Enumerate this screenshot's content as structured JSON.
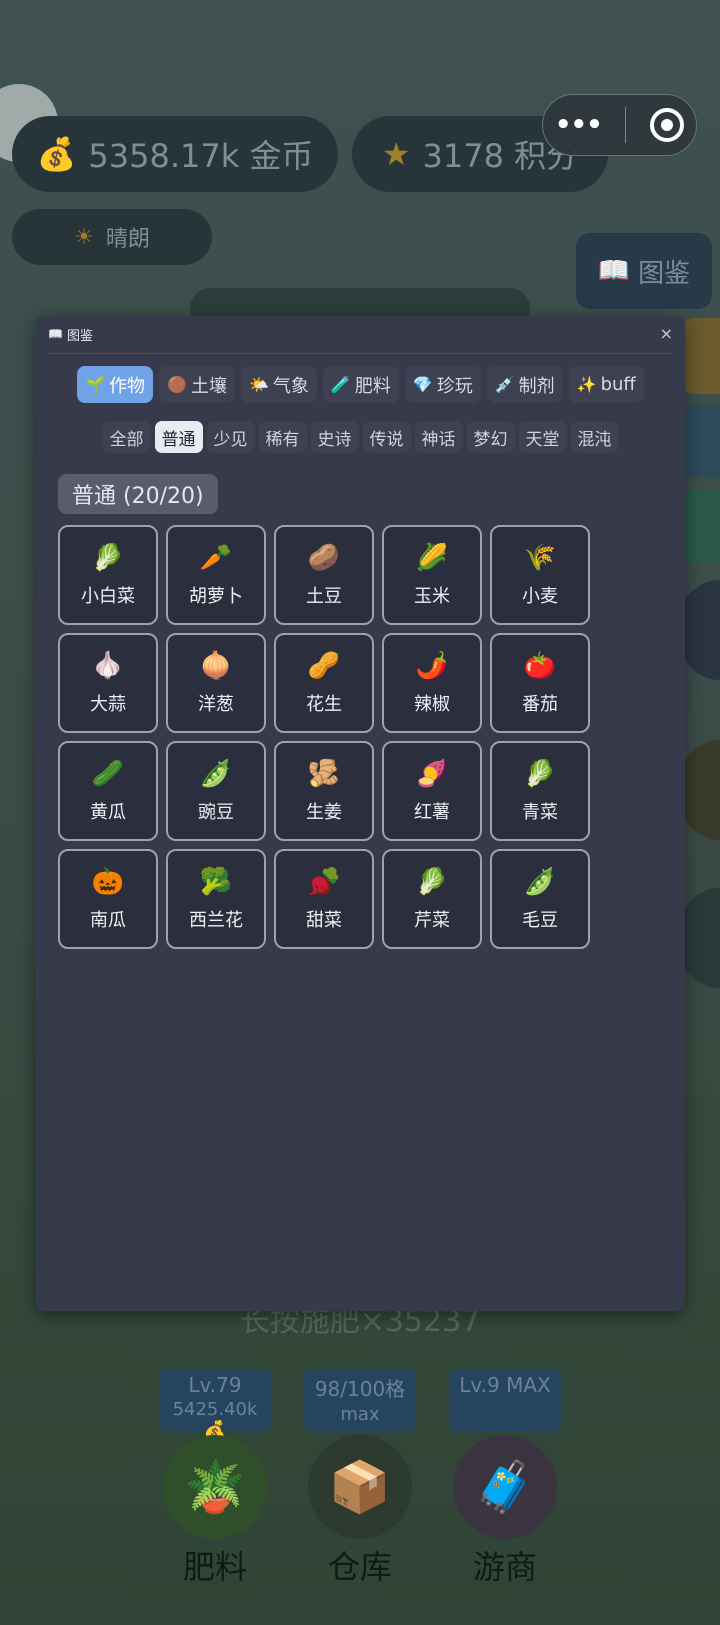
{
  "background": {
    "coins": "5358.17k 金币",
    "score": "3178 积分",
    "weather": "晴朗",
    "top_right_button": "图鉴",
    "bottom_hint": "长按施肥×35237",
    "level_boxes": [
      {
        "line1": "Lv.79",
        "line2": "5425.40k 💰"
      },
      {
        "line1": "98/100格",
        "line2": "max"
      },
      {
        "line1": "Lv.9 MAX",
        "line2": ""
      }
    ],
    "bottom_buttons": [
      {
        "label": "肥料",
        "icon": "🪴"
      },
      {
        "label": "仓库",
        "icon": "📦"
      },
      {
        "label": "游商",
        "icon": "🧳"
      }
    ]
  },
  "dialog": {
    "title": "图鉴",
    "close": "×",
    "categories": [
      {
        "icon": "🌱",
        "label": "作物",
        "active": true
      },
      {
        "icon": "🟤",
        "label": "土壤",
        "active": false
      },
      {
        "icon": "🌤️",
        "label": "气象",
        "active": false
      },
      {
        "icon": "🧪",
        "label": "肥料",
        "active": false
      },
      {
        "icon": "💎",
        "label": "珍玩",
        "active": false
      },
      {
        "icon": "💉",
        "label": "制剂",
        "active": false
      },
      {
        "icon": "✨",
        "label": "buff",
        "active": false
      }
    ],
    "rarities": [
      {
        "label": "全部",
        "active": false
      },
      {
        "label": "普通",
        "active": true
      },
      {
        "label": "少见",
        "active": false
      },
      {
        "label": "稀有",
        "active": false
      },
      {
        "label": "史诗",
        "active": false
      },
      {
        "label": "传说",
        "active": false
      },
      {
        "label": "神话",
        "active": false
      },
      {
        "label": "梦幻",
        "active": false
      },
      {
        "label": "天堂",
        "active": false
      },
      {
        "label": "混沌",
        "active": false
      }
    ],
    "section_title": "普通 (20/20)",
    "items": [
      {
        "icon": "🥬",
        "name": "小白菜"
      },
      {
        "icon": "🥕",
        "name": "胡萝卜"
      },
      {
        "icon": "🥔",
        "name": "土豆"
      },
      {
        "icon": "🌽",
        "name": "玉米"
      },
      {
        "icon": "🌾",
        "name": "小麦"
      },
      {
        "icon": "🧄",
        "name": "大蒜"
      },
      {
        "icon": "🧅",
        "name": "洋葱"
      },
      {
        "icon": "🥜",
        "name": "花生"
      },
      {
        "icon": "🌶️",
        "name": "辣椒"
      },
      {
        "icon": "🍅",
        "name": "番茄"
      },
      {
        "icon": "🥒",
        "name": "黄瓜"
      },
      {
        "icon": "🫛",
        "name": "豌豆"
      },
      {
        "icon": "🫚",
        "name": "生姜"
      },
      {
        "icon": "🍠",
        "name": "红薯"
      },
      {
        "icon": "🥬",
        "name": "青菜"
      },
      {
        "icon": "🎃",
        "name": "南瓜"
      },
      {
        "icon": "🥦",
        "name": "西兰花"
      },
      {
        "icon": "🫜",
        "name": "甜菜"
      },
      {
        "icon": "🥬",
        "name": "芹菜"
      },
      {
        "icon": "🫛",
        "name": "毛豆"
      }
    ]
  }
}
